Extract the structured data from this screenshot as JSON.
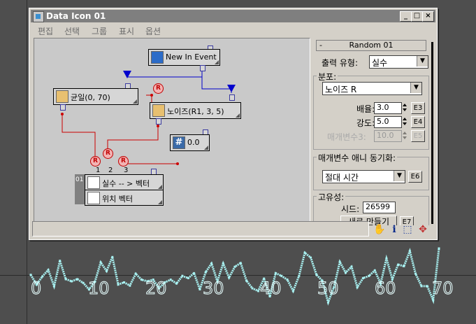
{
  "window": {
    "title": "Data Icon 01",
    "controls": {
      "minimize": "_",
      "maximize": "□",
      "close": "×"
    }
  },
  "menu": [
    "편집",
    "선택",
    "그룹",
    "표시",
    "옵션"
  ],
  "graph": {
    "nodes": {
      "event": "New In Event",
      "uniform": "균일(0, 70)",
      "noise": "노이즈(R1, 3, 5)",
      "constant": "0.0",
      "convert_top": "실수 -- > 벡터",
      "convert_bottom": "위치 벡터",
      "convert_index": "01"
    },
    "r_label": "R",
    "ports": [
      "1",
      "2",
      "3"
    ],
    "colors": {
      "event_wire": "#0000cc",
      "data_wire": "#cc0000"
    }
  },
  "panel": {
    "rollout_title": "Random 01",
    "rollout_toggle": "-",
    "output_type_label": "출력 유형:",
    "output_type_value": "실수",
    "distribution_group": "분포:",
    "distribution_value": "노이즈 R",
    "scale_label": "배율:",
    "scale_value": "3.0",
    "scale_btn": "E3",
    "strength_label": "강도:",
    "strength_value": "5.0",
    "strength_btn": "E4",
    "param3_label": "매개변수3:",
    "param3_value": "10.0",
    "param3_btn": "E5",
    "sync_group": "매개변수 애니 동기화:",
    "sync_value": "절대 시간",
    "sync_btn": "E6",
    "unique_group": "고유성:",
    "seed_label": "시드:",
    "seed_value": "26599",
    "new_button": "새로 만들기",
    "new_btn": "E7"
  },
  "status_icons": [
    "hand-icon",
    "info-icon",
    "zoom-region-icon",
    "pan-icon"
  ],
  "axis": {
    "ticks": [
      "0",
      "10",
      "20",
      "30",
      "40",
      "50",
      "60",
      "70"
    ],
    "tick_values": [
      0,
      10,
      20,
      30,
      40,
      50,
      60,
      70
    ],
    "curve_color": "#a8f0f0",
    "y_values": [
      0.51,
      0.33,
      0.48,
      0.6,
      0.3,
      0.77,
      0.43,
      0.39,
      0.43,
      0.36,
      0.24,
      0.38,
      0.74,
      0.58,
      0.84,
      0.33,
      0.37,
      0.31,
      0.53,
      0.42,
      0.39,
      0.42,
      0.26,
      0.37,
      0.42,
      0.35,
      0.49,
      0.45,
      0.54,
      0.24,
      0.56,
      0.72,
      0.39,
      0.72,
      0.46,
      0.66,
      0.73,
      0.4,
      0.26,
      0.21,
      0.44,
      0.11,
      0.54,
      0.49,
      0.42,
      0.21,
      0.49,
      0.92,
      0.83,
      0.51,
      0.4,
      0.0,
      0.28,
      0.75,
      0.55,
      0.66,
      0.28,
      0.45,
      0.49,
      0.59,
      0.35,
      0.81,
      0.43,
      0.7,
      0.67,
      0.95,
      0.53,
      0.3,
      0.3,
      0.04,
      1.0
    ]
  }
}
